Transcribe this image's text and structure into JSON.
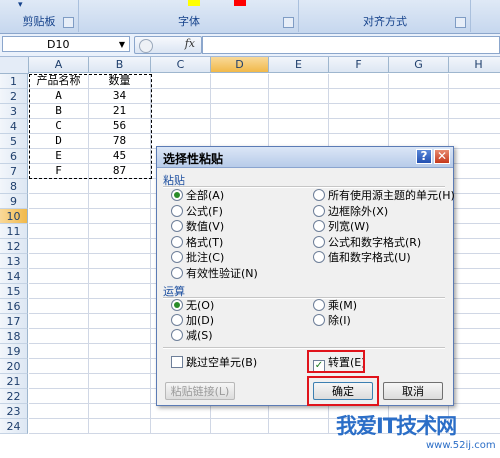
{
  "ribbon": {
    "groups": [
      {
        "label": "剪贴板"
      },
      {
        "label": "字体"
      },
      {
        "label": "对齐方式"
      }
    ]
  },
  "formula_bar": {
    "name_box": "D10",
    "fx_label": "fx",
    "formula": ""
  },
  "grid": {
    "columns": [
      "A",
      "B",
      "C",
      "D",
      "E",
      "F",
      "G",
      "H"
    ],
    "selected_column": "D",
    "rows": [
      "1",
      "2",
      "3",
      "4",
      "5",
      "6",
      "7",
      "8",
      "9",
      "10",
      "11",
      "12",
      "13",
      "14",
      "15",
      "16",
      "17",
      "18",
      "19",
      "20",
      "21",
      "22",
      "23",
      "24"
    ],
    "selected_row": "10",
    "cells": [
      [
        "产品名称",
        "数量"
      ],
      [
        "A",
        "34"
      ],
      [
        "B",
        "21"
      ],
      [
        "C",
        "56"
      ],
      [
        "D",
        "78"
      ],
      [
        "E",
        "45"
      ],
      [
        "F",
        "87"
      ]
    ]
  },
  "dialog": {
    "title": "选择性粘贴",
    "help_glyph": "?",
    "close_glyph": "✕",
    "paste_section": "粘贴",
    "paste_left": [
      {
        "label": "全部(A)",
        "checked": true
      },
      {
        "label": "公式(F)",
        "checked": false
      },
      {
        "label": "数值(V)",
        "checked": false
      },
      {
        "label": "格式(T)",
        "checked": false
      },
      {
        "label": "批注(C)",
        "checked": false
      },
      {
        "label": "有效性验证(N)",
        "checked": false
      }
    ],
    "paste_right": [
      {
        "label": "所有使用源主题的单元(H)",
        "checked": false
      },
      {
        "label": "边框除外(X)",
        "checked": false
      },
      {
        "label": "列宽(W)",
        "checked": false
      },
      {
        "label": "公式和数字格式(R)",
        "checked": false
      },
      {
        "label": "值和数字格式(U)",
        "checked": false
      }
    ],
    "op_section": "运算",
    "op_left": [
      {
        "label": "无(O)",
        "checked": true
      },
      {
        "label": "加(D)",
        "checked": false
      },
      {
        "label": "减(S)",
        "checked": false
      }
    ],
    "op_right": [
      {
        "label": "乘(M)",
        "checked": false
      },
      {
        "label": "除(I)",
        "checked": false
      }
    ],
    "skip_blanks": {
      "label": "跳过空单元(B)",
      "checked": false
    },
    "transpose": {
      "label": "转置(E)",
      "checked": true
    },
    "paste_link_button": "粘贴链接(L)",
    "ok_button": "确定",
    "cancel_button": "取消",
    "accent_color": "#e0131b"
  },
  "watermark": {
    "text": "我爱IT技术网",
    "url": "www.52ij.com"
  }
}
